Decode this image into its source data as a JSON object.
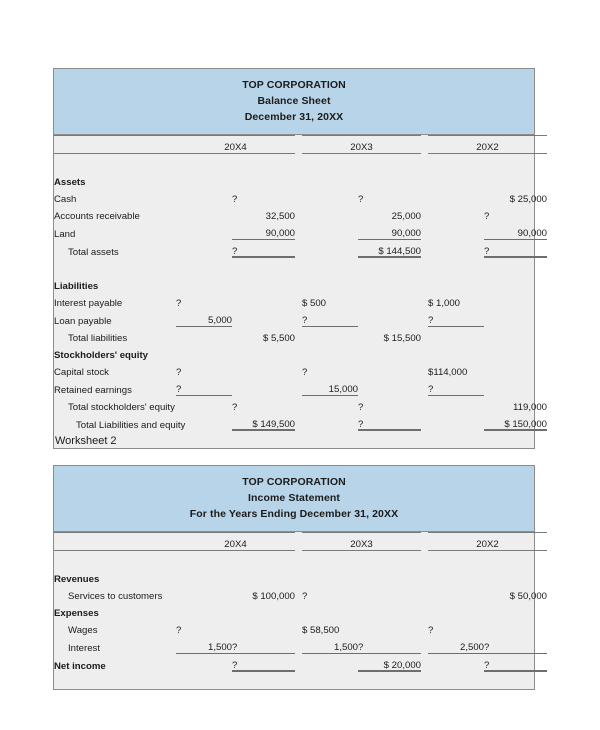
{
  "worksheet_label": "Worksheet 2",
  "balance_sheet": {
    "title_lines": [
      "TOP CORPORATION",
      "Balance Sheet",
      "December 31, 20XX"
    ],
    "year_headers": [
      "20X4",
      "20X3",
      "20X2"
    ],
    "sections": {
      "assets_heading": "Assets",
      "liabilities_heading": "Liabilities",
      "equity_heading": "Stockholders' equity"
    },
    "rows": {
      "cash": "Cash",
      "accounts_receivable": "Accounts receivable",
      "land": "Land",
      "total_assets": "Total assets",
      "interest_payable": "Interest payable",
      "loan_payable": "Loan payable",
      "total_liabilities": "Total liabilities",
      "capital_stock": "Capital stock",
      "retained_earnings": "Retained earnings",
      "total_equity": "Total stockholders' equity",
      "total_liab_equity": "Total Liabilities and equity"
    },
    "values": {
      "cash": {
        "x4_in": "",
        "x4_out": "?",
        "x3_in": "",
        "x3_out": "?",
        "x2_in": "",
        "x2_out": "$ 25,000"
      },
      "accounts_receivable": {
        "x4_in": "",
        "x4_out": "32,500",
        "x3_in": "",
        "x3_out": "25,000",
        "x2_in": "",
        "x2_out": "?"
      },
      "land": {
        "x4_in": "",
        "x4_out": "90,000",
        "x3_in": "",
        "x3_out": "90,000",
        "x2_in": "",
        "x2_out": "90,000"
      },
      "total_assets": {
        "x4_in": "",
        "x4_out": "?",
        "x3_in": "",
        "x3_out": "$ 144,500",
        "x2_in": "",
        "x2_out": "?"
      },
      "interest_payable": {
        "x4_in": "?",
        "x4_out": "",
        "x3_in": "$   500",
        "x3_out": "",
        "x2_in": "$  1,000",
        "x2_out": ""
      },
      "loan_payable": {
        "x4_in": "5,000",
        "x4_out": "",
        "x3_in": "?",
        "x3_out": "",
        "x2_in": "?",
        "x2_out": ""
      },
      "total_liabilities": {
        "x4_in": "",
        "x4_out": "$    5,500",
        "x3_in": "",
        "x3_out": "$ 15,500",
        "x2_in": "",
        "x2_out": ""
      },
      "capital_stock": {
        "x4_in": "?",
        "x4_out": "",
        "x3_in": "?",
        "x3_out": "",
        "x2_in": "$114,000",
        "x2_out": ""
      },
      "retained_earnings": {
        "x4_in": "?",
        "x4_out": "",
        "x3_in": "15,000",
        "x3_out": "",
        "x2_in": "?",
        "x2_out": ""
      },
      "total_equity": {
        "x4_in": "",
        "x4_out": "?",
        "x3_in": "",
        "x3_out": "?",
        "x2_in": "",
        "x2_out": "119,000"
      },
      "total_liab_equity": {
        "x4_in": "",
        "x4_out": "$ 149,500",
        "x3_in": "",
        "x3_out": "?",
        "x2_in": "",
        "x2_out": "$ 150,000"
      }
    }
  },
  "income_statement": {
    "title_lines": [
      "TOP CORPORATION",
      "Income Statement",
      "For the Years Ending December 31, 20XX"
    ],
    "year_headers": [
      "20X4",
      "20X3",
      "20X2"
    ],
    "sections": {
      "revenues_heading": "Revenues",
      "expenses_heading": "Expenses"
    },
    "rows": {
      "services": "Services to customers",
      "wages": "Wages",
      "interest": "Interest",
      "net_income": "Net income"
    },
    "values": {
      "services": {
        "x4_in": "",
        "x4_out": "$ 100,000",
        "x3_in": "?",
        "x3_out": "",
        "x2_in": "",
        "x2_out": "$ 50,000"
      },
      "wages": {
        "x4_in": "?",
        "x4_out": "",
        "x3_in": "$ 58,500",
        "x3_out": "",
        "x2_in": "?",
        "x2_out": ""
      },
      "interest": {
        "x4_in": "1,500",
        "x4_out": "?",
        "x3_in": "1,500",
        "x3_out": "?",
        "x2_in": "2,500",
        "x2_out": "?"
      },
      "net_income": {
        "x4_in": "",
        "x4_out": "?",
        "x3_in": "",
        "x3_out": "$ 20,000",
        "x2_in": "",
        "x2_out": "?"
      }
    }
  }
}
